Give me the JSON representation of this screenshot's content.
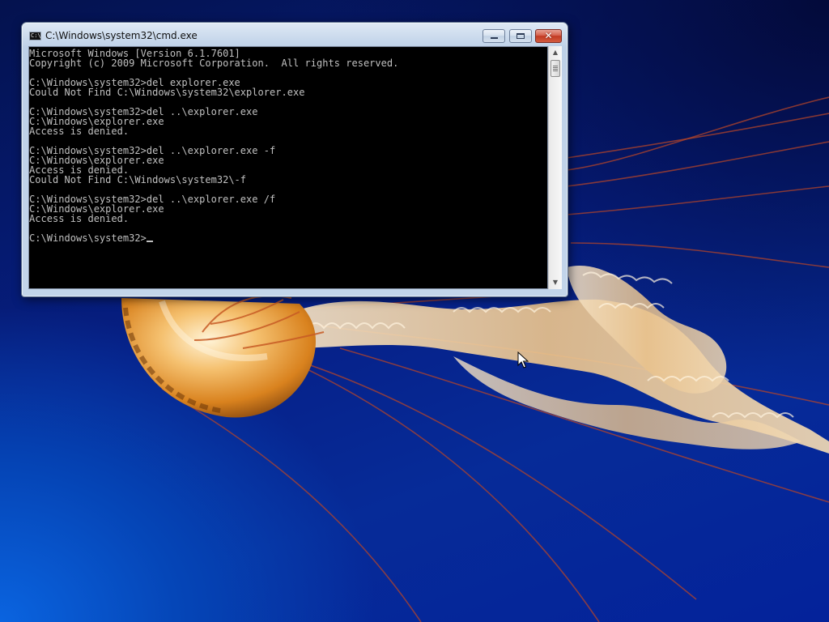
{
  "window": {
    "title": "C:\\Windows\\system32\\cmd.exe",
    "icon": "cmd-icon",
    "icon_text": "C:\\",
    "buttons": {
      "minimize_icon": "minimize-icon",
      "maximize_icon": "maximize-icon",
      "close_label": "✕"
    }
  },
  "console": {
    "text": "Microsoft Windows [Version 6.1.7601]\nCopyright (c) 2009 Microsoft Corporation.  All rights reserved.\n\nC:\\Windows\\system32>del explorer.exe\nCould Not Find C:\\Windows\\system32\\explorer.exe\n\nC:\\Windows\\system32>del ..\\explorer.exe\nC:\\Windows\\explorer.exe\nAccess is denied.\n\nC:\\Windows\\system32>del ..\\explorer.exe -f\nC:\\Windows\\explorer.exe\nAccess is denied.\nCould Not Find C:\\Windows\\system32\\-f\n\nC:\\Windows\\system32>del ..\\explorer.exe /f\nC:\\Windows\\explorer.exe\nAccess is denied.\n\nC:\\Windows\\system32>",
    "background_color": "#000000",
    "text_color": "#c0c0c0"
  },
  "scrollbar": {
    "up_arrow": "▲",
    "down_arrow": "▼",
    "position_fraction": 0
  },
  "desktop": {
    "wallpaper": "jellyfish-wallpaper",
    "accent_colors": [
      "#062b98",
      "#0a64e0",
      "#e8a040"
    ]
  },
  "pointer": {
    "icon": "arrow-cursor-icon"
  }
}
